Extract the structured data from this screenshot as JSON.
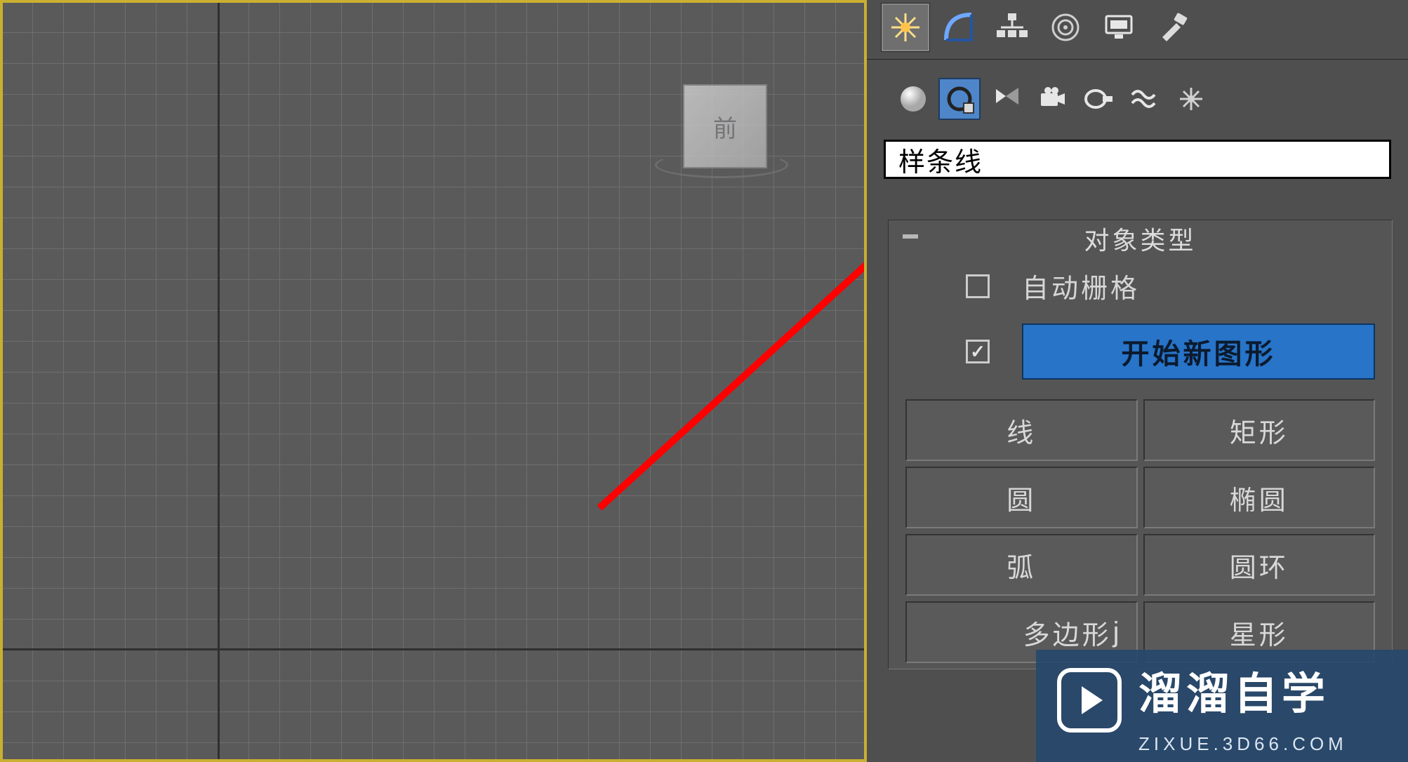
{
  "viewport": {
    "cube_face": "前"
  },
  "panel_tabs": [
    {
      "name": "create",
      "selected": true
    },
    {
      "name": "modify"
    },
    {
      "name": "hierarchy"
    },
    {
      "name": "motion"
    },
    {
      "name": "display"
    },
    {
      "name": "utilities"
    }
  ],
  "subcategories": [
    {
      "name": "geometry",
      "selected": false
    },
    {
      "name": "shapes",
      "selected": true
    },
    {
      "name": "lights"
    },
    {
      "name": "cameras"
    },
    {
      "name": "helpers"
    },
    {
      "name": "spacewarps"
    },
    {
      "name": "systems"
    }
  ],
  "dropdown": {
    "value": "样条线"
  },
  "rollout": {
    "title": "对象类型",
    "autogrid": {
      "label": "自动栅格",
      "checked": false
    },
    "startshape": {
      "label": "开始新图形",
      "checked": true
    },
    "buttons": [
      [
        "线",
        "矩形"
      ],
      [
        "圆",
        "椭圆"
      ],
      [
        "弧",
        "圆环"
      ],
      [
        "多边形",
        "星形"
      ]
    ],
    "row3_annotations": {
      "left_prefix": "j",
      "right_prefix": ""
    }
  },
  "watermark": {
    "title": "溜溜自学",
    "url": "ZIXUE.3D66.COM"
  }
}
